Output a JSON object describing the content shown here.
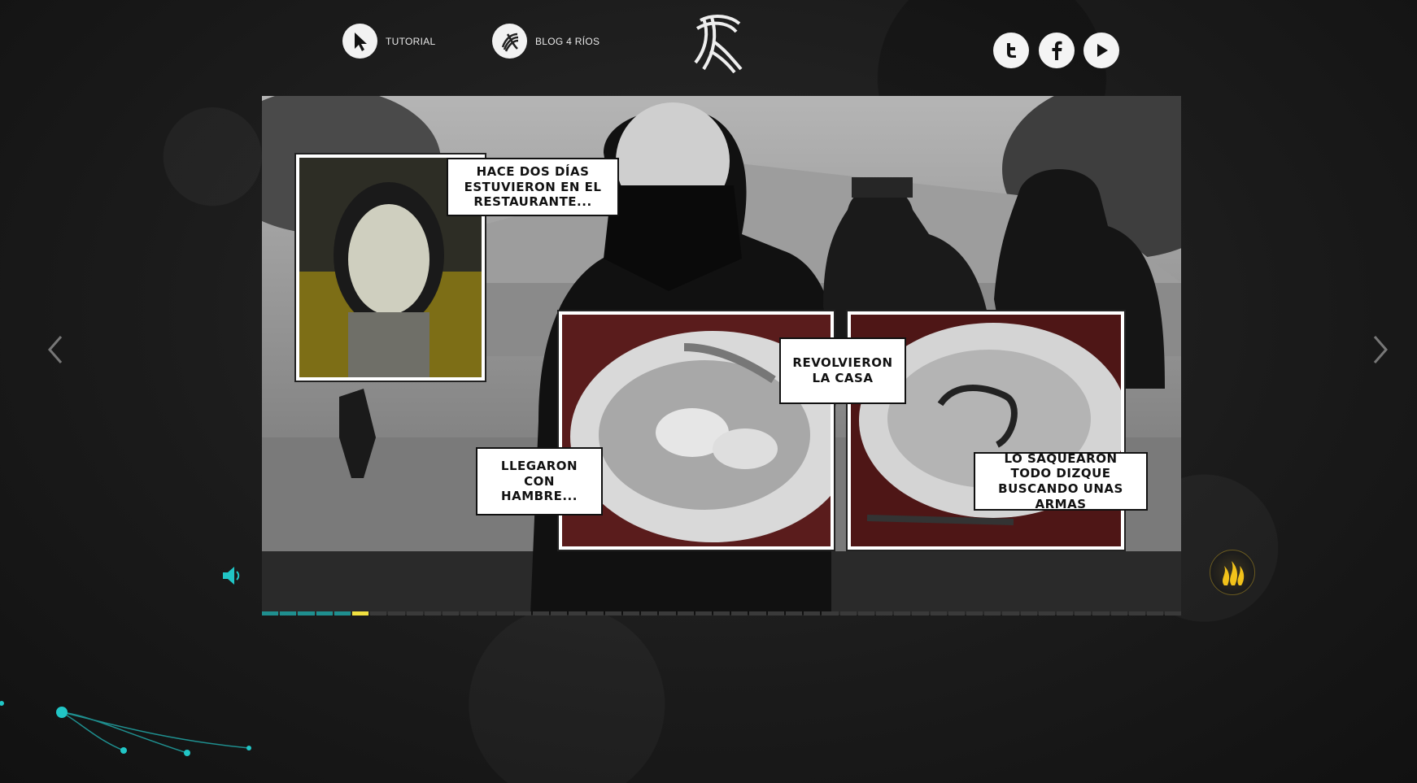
{
  "header": {
    "tutorial_label": "TUTORIAL",
    "blog_label": "BLOG 4 RÍOS"
  },
  "social": {
    "twitter_icon": "twitter-icon",
    "facebook_icon": "facebook-icon",
    "youtube_icon": "play-icon"
  },
  "comic": {
    "bubble_1": "Hace dos días estuvieron en el restaurante...",
    "bubble_2": "Revolvieron la casa",
    "bubble_3": "Llegaron con hambre...",
    "bubble_4": "Lo saquearon todo dizque buscando unas armas"
  },
  "progress": {
    "total_segments": 51,
    "completed_segments": 5,
    "current_segment": 6,
    "accent_color": "#1f8f8f",
    "current_color": "#f0e040"
  },
  "colors": {
    "teal": "#21c6c6",
    "gold": "#f2c21a"
  }
}
